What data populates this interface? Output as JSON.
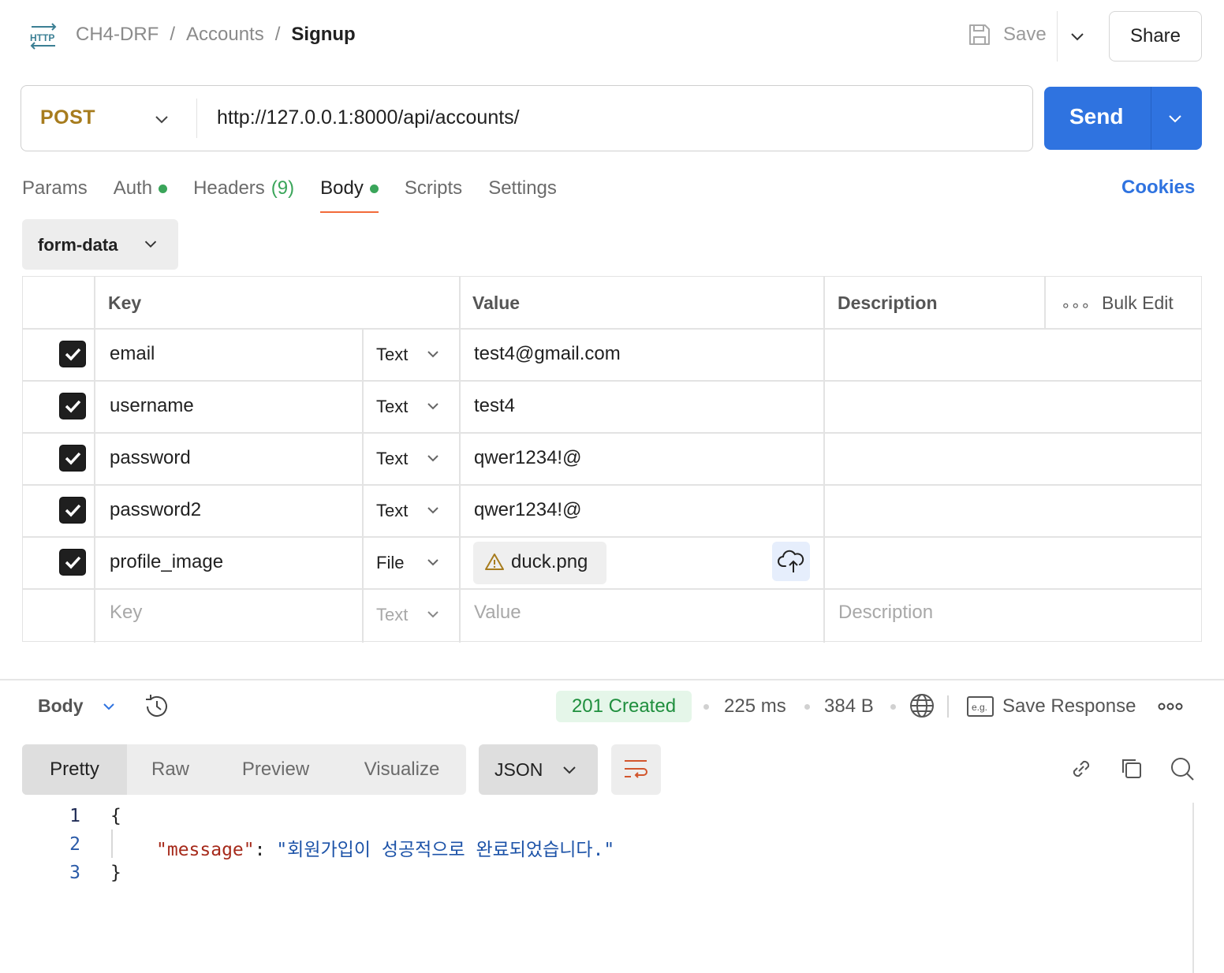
{
  "header": {
    "protocol_icon": "http-icon",
    "breadcrumb": [
      "CH4-DRF",
      "Accounts",
      "Signup"
    ],
    "separator": "/",
    "save_label": "Save",
    "share_label": "Share"
  },
  "request": {
    "method": "POST",
    "url": "http://127.0.0.1:8000/api/accounts/",
    "send_label": "Send"
  },
  "request_tabs": {
    "params": "Params",
    "auth": "Auth",
    "headers": "Headers",
    "headers_count": "(9)",
    "body": "Body",
    "scripts": "Scripts",
    "settings": "Settings",
    "active": "Body",
    "cookies": "Cookies"
  },
  "body_mode": "form-data",
  "table": {
    "headers": {
      "key": "Key",
      "value": "Value",
      "description": "Description",
      "bulk_edit": "Bulk Edit",
      "more": "∘∘∘"
    },
    "rows": [
      {
        "checked": true,
        "key": "email",
        "type": "Text",
        "value": "test4@gmail.com"
      },
      {
        "checked": true,
        "key": "username",
        "type": "Text",
        "value": "test4"
      },
      {
        "checked": true,
        "key": "password",
        "type": "Text",
        "value": "qwer1234!@"
      },
      {
        "checked": true,
        "key": "password2",
        "type": "Text",
        "value": "qwer1234!@"
      },
      {
        "checked": true,
        "key": "profile_image",
        "type": "File",
        "value": "duck.png"
      }
    ],
    "placeholder": {
      "key": "Key",
      "type": "Text",
      "value": "Value",
      "description": "Description"
    }
  },
  "response": {
    "body_label": "Body",
    "status": "201 Created",
    "time": "225 ms",
    "size": "384 B",
    "save_response": "Save Response",
    "views": [
      "Pretty",
      "Raw",
      "Preview",
      "Visualize"
    ],
    "active_view": "Pretty",
    "format": "JSON",
    "code": {
      "line_numbers": [
        "1",
        "2",
        "3"
      ],
      "open_brace": "{",
      "key": "\"message\"",
      "colon": ": ",
      "value": "\"회원가입이 성공적으로 완료되었습니다.\"",
      "close_brace": "}"
    }
  },
  "colors": {
    "send": "#2f73e0",
    "method": "#a77c1e",
    "status_text": "#1f8f3e",
    "status_bg": "#e5f6e9",
    "active_tab_underline": "#f26b3a",
    "dot": "#3aa55a"
  }
}
